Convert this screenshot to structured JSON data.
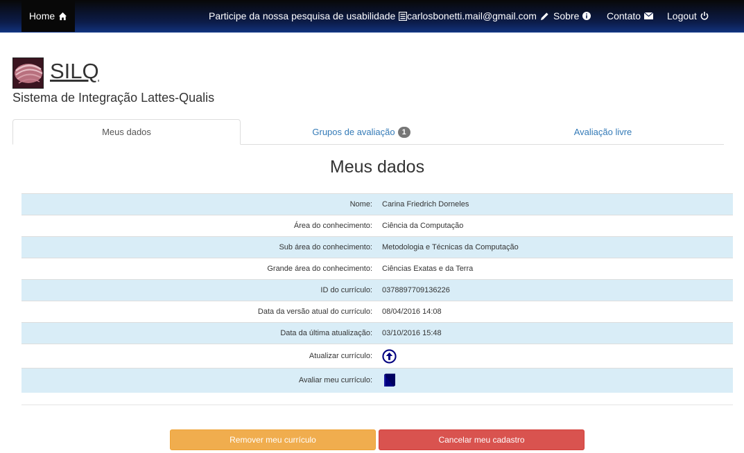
{
  "navbar": {
    "home_label": "Home",
    "survey_label": "Participe da nossa pesquisa de usabilidade",
    "email_label": "carlosbonetti.mail@gmail.com",
    "about_label": "Sobre",
    "contact_label": "Contato",
    "logout_label": "Logout"
  },
  "brand": {
    "name": "SILQ",
    "subtitle": "Sistema de Integração Lattes-Qualis"
  },
  "tabs": [
    {
      "label": "Meus dados"
    },
    {
      "label": "Grupos de avaliação",
      "badge": "1"
    },
    {
      "label": "Avaliação livre"
    }
  ],
  "page_heading": "Meus dados",
  "profile": {
    "rows": [
      {
        "label": "Nome:",
        "value": "Carina Friedrich Dorneles"
      },
      {
        "label": "Área do conhecimento:",
        "value": "Ciência da Computação"
      },
      {
        "label": "Sub área do conhecimento:",
        "value": "Metodologia e Técnicas da Computação"
      },
      {
        "label": "Grande área do conhecimento:",
        "value": "Ciências Exatas e da Terra"
      },
      {
        "label": "ID do currículo:",
        "value": "0378897709136226"
      },
      {
        "label": "Data da versão atual do currículo:",
        "value": "08/04/2016 14:08"
      },
      {
        "label": "Data da última atualização:",
        "value": "03/10/2016 15:48"
      }
    ],
    "update_label": "Atualizar currículo:",
    "update_icon": "circle-arrow-up-icon",
    "evaluate_label": "Avaliar meu currículo:",
    "evaluate_icon": "book-icon"
  },
  "actions": {
    "remove_label": "Remover meu currículo",
    "cancel_label": "Cancelar meu cadastro"
  },
  "colors": {
    "row_stripe": "#d9edf7",
    "link": "#337ab7",
    "warning": "#f0ad4e",
    "danger": "#d9534f",
    "icon_navy": "#000080"
  }
}
